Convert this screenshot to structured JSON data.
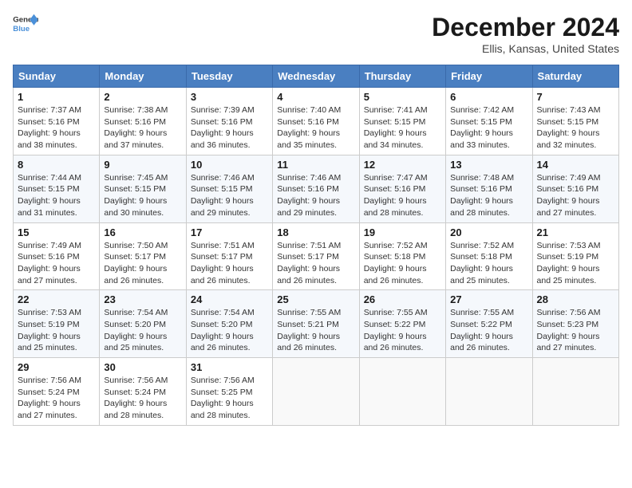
{
  "header": {
    "logo_line1": "General",
    "logo_line2": "Blue",
    "month": "December 2024",
    "location": "Ellis, Kansas, United States"
  },
  "weekdays": [
    "Sunday",
    "Monday",
    "Tuesday",
    "Wednesday",
    "Thursday",
    "Friday",
    "Saturday"
  ],
  "weeks": [
    [
      {
        "day": "1",
        "info": "Sunrise: 7:37 AM\nSunset: 5:16 PM\nDaylight: 9 hours\nand 38 minutes."
      },
      {
        "day": "2",
        "info": "Sunrise: 7:38 AM\nSunset: 5:16 PM\nDaylight: 9 hours\nand 37 minutes."
      },
      {
        "day": "3",
        "info": "Sunrise: 7:39 AM\nSunset: 5:16 PM\nDaylight: 9 hours\nand 36 minutes."
      },
      {
        "day": "4",
        "info": "Sunrise: 7:40 AM\nSunset: 5:16 PM\nDaylight: 9 hours\nand 35 minutes."
      },
      {
        "day": "5",
        "info": "Sunrise: 7:41 AM\nSunset: 5:15 PM\nDaylight: 9 hours\nand 34 minutes."
      },
      {
        "day": "6",
        "info": "Sunrise: 7:42 AM\nSunset: 5:15 PM\nDaylight: 9 hours\nand 33 minutes."
      },
      {
        "day": "7",
        "info": "Sunrise: 7:43 AM\nSunset: 5:15 PM\nDaylight: 9 hours\nand 32 minutes."
      }
    ],
    [
      {
        "day": "8",
        "info": "Sunrise: 7:44 AM\nSunset: 5:15 PM\nDaylight: 9 hours\nand 31 minutes."
      },
      {
        "day": "9",
        "info": "Sunrise: 7:45 AM\nSunset: 5:15 PM\nDaylight: 9 hours\nand 30 minutes."
      },
      {
        "day": "10",
        "info": "Sunrise: 7:46 AM\nSunset: 5:15 PM\nDaylight: 9 hours\nand 29 minutes."
      },
      {
        "day": "11",
        "info": "Sunrise: 7:46 AM\nSunset: 5:16 PM\nDaylight: 9 hours\nand 29 minutes."
      },
      {
        "day": "12",
        "info": "Sunrise: 7:47 AM\nSunset: 5:16 PM\nDaylight: 9 hours\nand 28 minutes."
      },
      {
        "day": "13",
        "info": "Sunrise: 7:48 AM\nSunset: 5:16 PM\nDaylight: 9 hours\nand 28 minutes."
      },
      {
        "day": "14",
        "info": "Sunrise: 7:49 AM\nSunset: 5:16 PM\nDaylight: 9 hours\nand 27 minutes."
      }
    ],
    [
      {
        "day": "15",
        "info": "Sunrise: 7:49 AM\nSunset: 5:16 PM\nDaylight: 9 hours\nand 27 minutes."
      },
      {
        "day": "16",
        "info": "Sunrise: 7:50 AM\nSunset: 5:17 PM\nDaylight: 9 hours\nand 26 minutes."
      },
      {
        "day": "17",
        "info": "Sunrise: 7:51 AM\nSunset: 5:17 PM\nDaylight: 9 hours\nand 26 minutes."
      },
      {
        "day": "18",
        "info": "Sunrise: 7:51 AM\nSunset: 5:17 PM\nDaylight: 9 hours\nand 26 minutes."
      },
      {
        "day": "19",
        "info": "Sunrise: 7:52 AM\nSunset: 5:18 PM\nDaylight: 9 hours\nand 26 minutes."
      },
      {
        "day": "20",
        "info": "Sunrise: 7:52 AM\nSunset: 5:18 PM\nDaylight: 9 hours\nand 25 minutes."
      },
      {
        "day": "21",
        "info": "Sunrise: 7:53 AM\nSunset: 5:19 PM\nDaylight: 9 hours\nand 25 minutes."
      }
    ],
    [
      {
        "day": "22",
        "info": "Sunrise: 7:53 AM\nSunset: 5:19 PM\nDaylight: 9 hours\nand 25 minutes."
      },
      {
        "day": "23",
        "info": "Sunrise: 7:54 AM\nSunset: 5:20 PM\nDaylight: 9 hours\nand 25 minutes."
      },
      {
        "day": "24",
        "info": "Sunrise: 7:54 AM\nSunset: 5:20 PM\nDaylight: 9 hours\nand 26 minutes."
      },
      {
        "day": "25",
        "info": "Sunrise: 7:55 AM\nSunset: 5:21 PM\nDaylight: 9 hours\nand 26 minutes."
      },
      {
        "day": "26",
        "info": "Sunrise: 7:55 AM\nSunset: 5:22 PM\nDaylight: 9 hours\nand 26 minutes."
      },
      {
        "day": "27",
        "info": "Sunrise: 7:55 AM\nSunset: 5:22 PM\nDaylight: 9 hours\nand 26 minutes."
      },
      {
        "day": "28",
        "info": "Sunrise: 7:56 AM\nSunset: 5:23 PM\nDaylight: 9 hours\nand 27 minutes."
      }
    ],
    [
      {
        "day": "29",
        "info": "Sunrise: 7:56 AM\nSunset: 5:24 PM\nDaylight: 9 hours\nand 27 minutes."
      },
      {
        "day": "30",
        "info": "Sunrise: 7:56 AM\nSunset: 5:24 PM\nDaylight: 9 hours\nand 28 minutes."
      },
      {
        "day": "31",
        "info": "Sunrise: 7:56 AM\nSunset: 5:25 PM\nDaylight: 9 hours\nand 28 minutes."
      },
      null,
      null,
      null,
      null
    ]
  ]
}
